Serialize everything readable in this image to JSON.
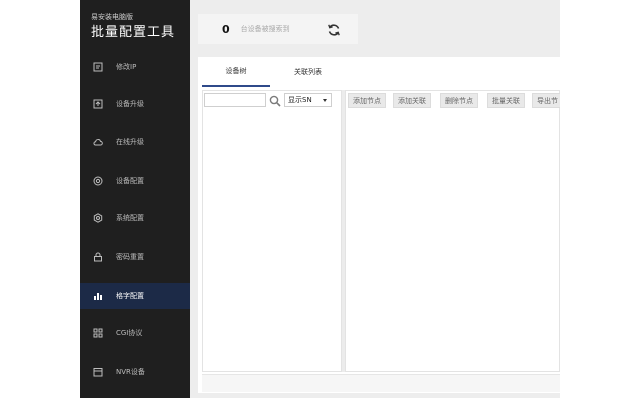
{
  "app": {
    "subtitle": "易安装电脑版",
    "title": "批量配置工具"
  },
  "sidebar": {
    "items": [
      {
        "label": "修改IP",
        "icon": "edit-icon"
      },
      {
        "label": "设备升级",
        "icon": "upgrade-icon"
      },
      {
        "label": "在线升级",
        "icon": "cloud-icon"
      },
      {
        "label": "设备配置",
        "icon": "settings-circle-icon"
      },
      {
        "label": "系统配置",
        "icon": "gear-icon"
      },
      {
        "label": "密码重置",
        "icon": "lock-icon"
      },
      {
        "label": "格字配置",
        "icon": "bar-chart-icon"
      },
      {
        "label": "CGI协议",
        "icon": "grid-icon"
      },
      {
        "label": "NVR设备",
        "icon": "calendar-icon"
      }
    ],
    "active_index": 6
  },
  "status": {
    "count": "0",
    "label": "台设备被搜索到"
  },
  "tabs": [
    {
      "label": "设备树"
    },
    {
      "label": "关联列表"
    }
  ],
  "tree": {
    "search_value": "",
    "filter_selected": "显示SN"
  },
  "toolbar": {
    "buttons": [
      "添加节点",
      "添加关联",
      "删除节点",
      "批量关联",
      "导出节"
    ]
  },
  "colors": {
    "sidebar_bg": "#1f1f1f",
    "active_nav_bg": "#1c2a47",
    "tab_underline": "#2f4a8a",
    "window_bg": "#ededed"
  }
}
